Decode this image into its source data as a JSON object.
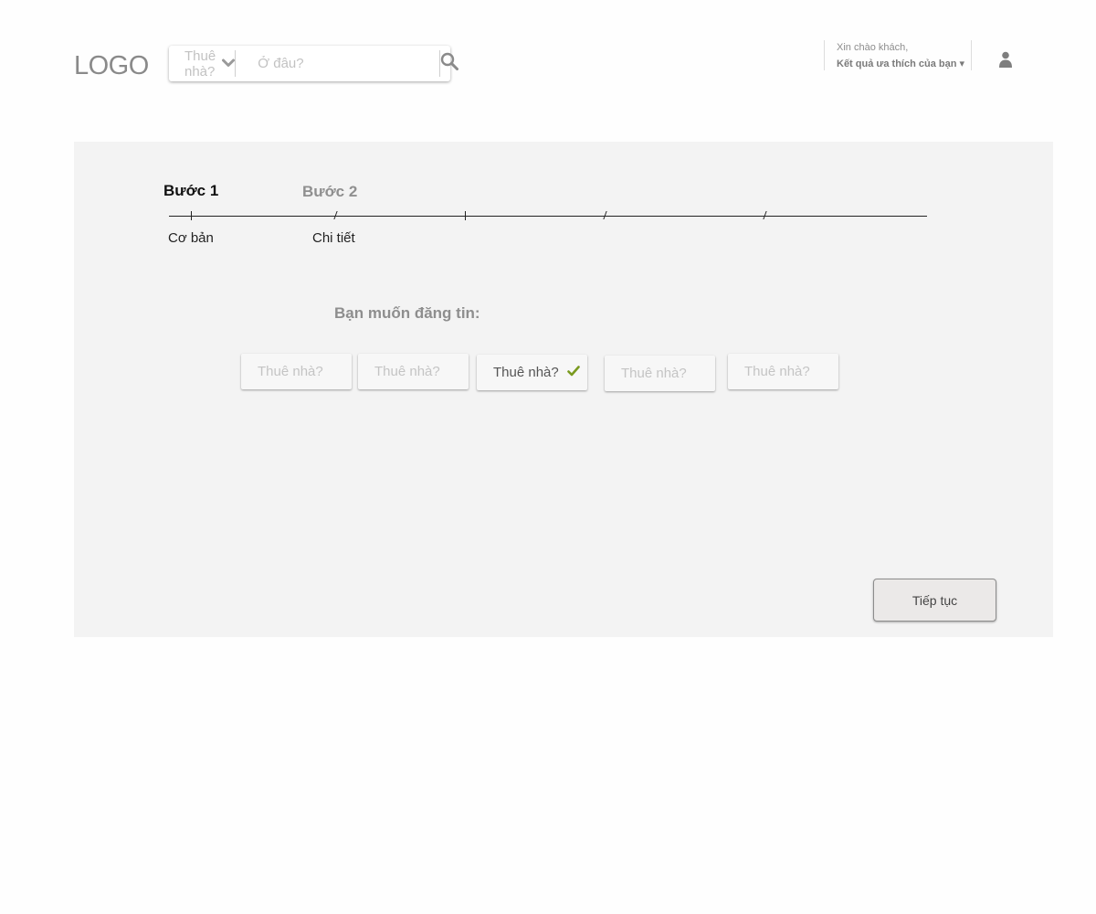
{
  "header": {
    "logo": "LOGO",
    "search": {
      "type_value": "Thuê nhà?",
      "where_placeholder": "Ở đâu?"
    },
    "greeting": "Xin chào khách,",
    "favorites": "Kết quả ưa thích của bạn ▾"
  },
  "steps": {
    "step1_title": "Bước 1",
    "step1_sub": "Cơ bản",
    "step2_title": "Bước 2",
    "step2_sub": "Chi tiết"
  },
  "form": {
    "question": "Bạn muốn đăng tin:",
    "options": [
      {
        "label": "Thuê nhà?",
        "selected": false
      },
      {
        "label": "Thuê nhà?",
        "selected": false
      },
      {
        "label": "Thuê nhà?",
        "selected": true
      },
      {
        "label": "Thuê nhà?",
        "selected": false
      },
      {
        "label": "Thuê nhà?",
        "selected": false
      }
    ],
    "next_label": "Tiếp tục"
  },
  "colors": {
    "panel_bg": "#f3f3f3",
    "check_green": "#7a9a1f"
  },
  "icons": [
    "chevron-down-icon",
    "search-icon",
    "user-icon",
    "check-icon"
  ]
}
